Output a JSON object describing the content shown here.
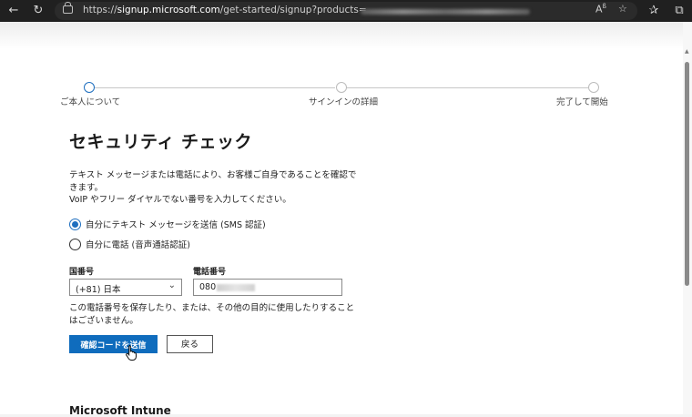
{
  "browser": {
    "url_scheme": "https://",
    "url_host": "signup.microsoft.com",
    "url_path": "/get-started/signup?products="
  },
  "stepper": {
    "steps": [
      {
        "label": "ご本人について",
        "state": "active"
      },
      {
        "label": "サインインの詳細",
        "state": "inactive"
      },
      {
        "label": "完了して開始",
        "state": "inactive"
      }
    ]
  },
  "form": {
    "title": "セキュリティ チェック",
    "description_line1": "テキスト メッセージまたは電話により、お客様ご自身であることを確認できます。",
    "description_line2": "VoIP やフリー ダイヤルでない番号を入力してください。",
    "options": [
      {
        "label": "自分にテキスト メッセージを送信 (SMS 認証)",
        "checked": true
      },
      {
        "label": "自分に電話 (音声通話認証)",
        "checked": false
      }
    ],
    "country_label": "国番号",
    "country_value": "(+81) 日本",
    "phone_label": "電話番号",
    "phone_value": "080",
    "note": "この電話番号を保存したり、または、その他の目的に使用したりすることはございません。",
    "send_button": "確認コードを送信",
    "back_button": "戻る"
  },
  "next_section": {
    "title": "Microsoft Intune"
  },
  "colors": {
    "accent": "#0f6cbd",
    "browser_bar": "#202020"
  }
}
